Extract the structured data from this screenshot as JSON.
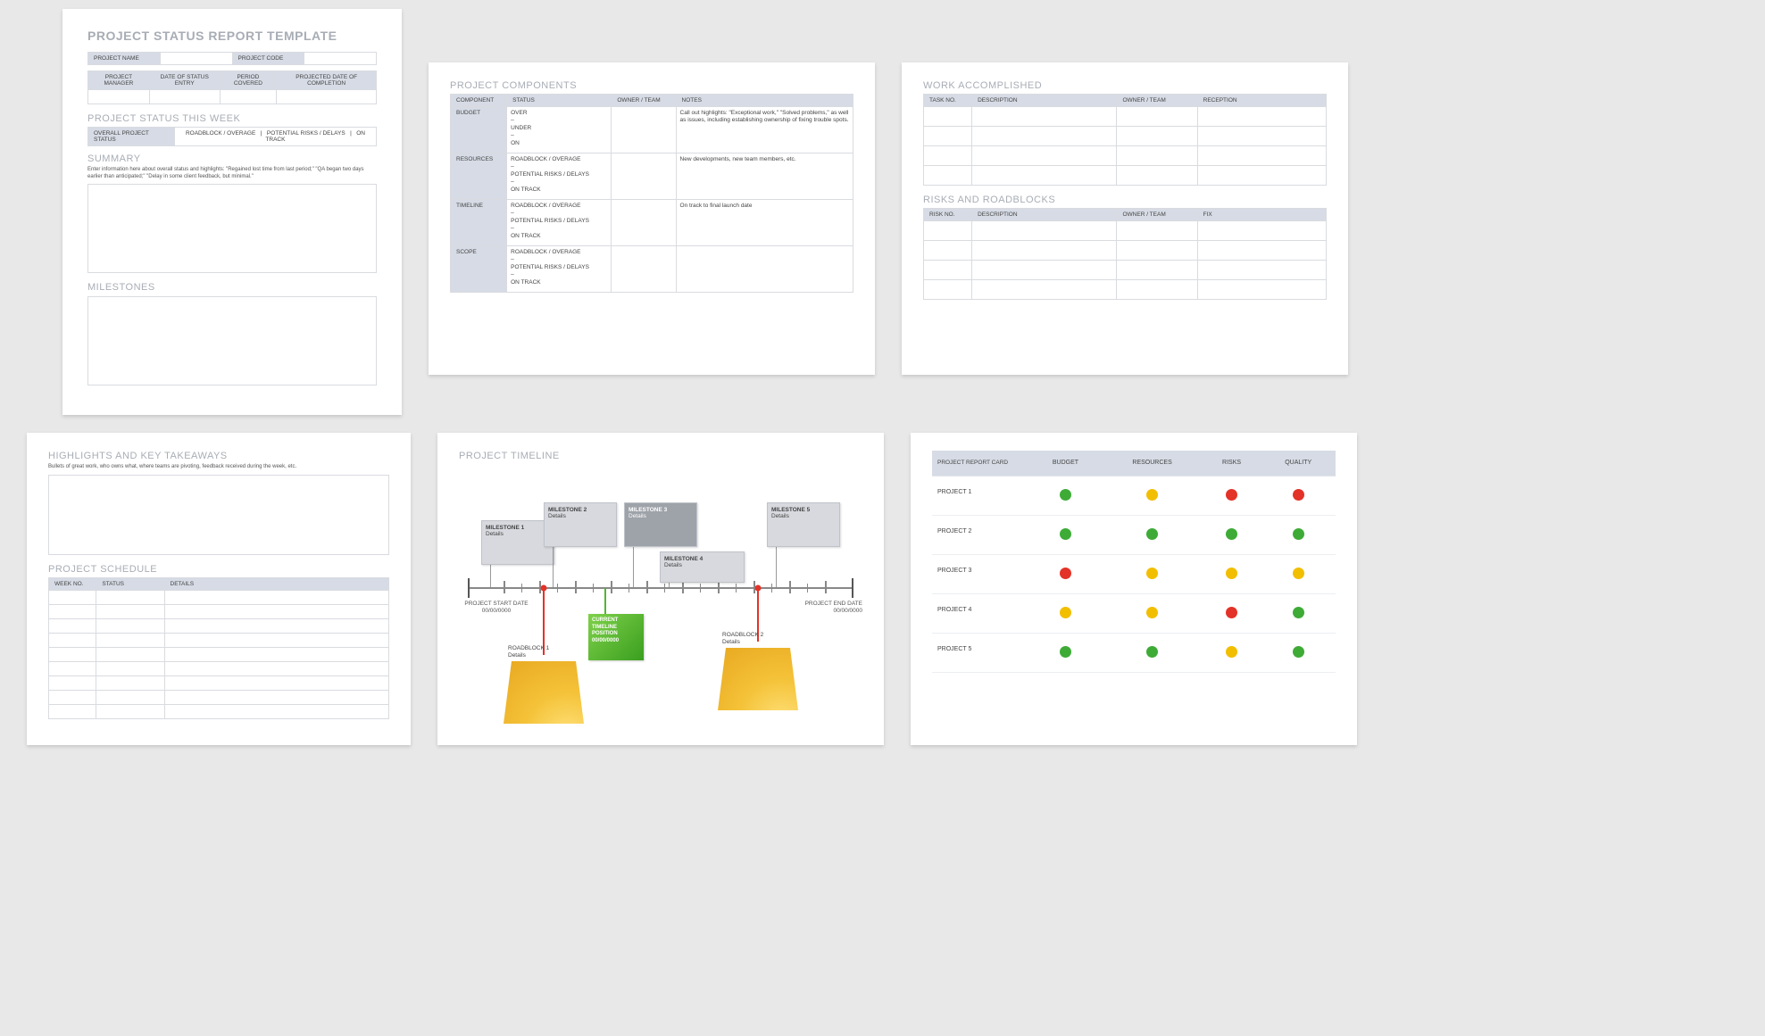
{
  "card1": {
    "title": "PROJECT STATUS REPORT TEMPLATE",
    "nameRow": {
      "name_label": "PROJECT NAME",
      "code_label": "PROJECT CODE"
    },
    "infoHeaders": [
      "PROJECT MANAGER",
      "DATE OF STATUS ENTRY",
      "PERIOD COVERED",
      "PROJECTED DATE OF COMPLETION"
    ],
    "statusSection": "PROJECT STATUS THIS WEEK",
    "statusRow": {
      "label": "OVERALL PROJECT STATUS",
      "items": [
        "ROADBLOCK / OVERAGE",
        "|",
        "POTENTIAL RISKS / DELAYS",
        "|",
        "ON TRACK"
      ]
    },
    "summary": {
      "title": "SUMMARY",
      "hint": "Enter information here about overall status and highlights: \"Regained lost time from last period;\" \"QA began two days earlier than anticipated;\" \"Delay in some client feedback, but minimal.\""
    },
    "milestones": {
      "title": "MILESTONES"
    }
  },
  "card2": {
    "title": "PROJECT COMPONENTS",
    "headers": [
      "COMPONENT",
      "STATUS",
      "OWNER / TEAM",
      "NOTES"
    ],
    "rows": [
      {
        "component": "BUDGET",
        "status": "OVER\n–\nUNDER\n–\nON",
        "owner": "",
        "notes": "Call out highlights: \"Exceptional work,\" \"Solved problems,\" as well as issues, including establishing ownership of fixing trouble spots."
      },
      {
        "component": "RESOURCES",
        "status": "ROADBLOCK / OVERAGE\n–\nPOTENTIAL RISKS / DELAYS\n–\nON TRACK",
        "owner": "",
        "notes": "New developments, new team members, etc."
      },
      {
        "component": "TIMELINE",
        "status": "ROADBLOCK / OVERAGE\n–\nPOTENTIAL RISKS / DELAYS\n–\nON TRACK",
        "owner": "",
        "notes": "On track to final launch date"
      },
      {
        "component": "SCOPE",
        "status": "ROADBLOCK / OVERAGE\n–\nPOTENTIAL RISKS / DELAYS\n–\nON TRACK",
        "owner": "",
        "notes": ""
      }
    ]
  },
  "card3": {
    "work": {
      "title": "WORK ACCOMPLISHED",
      "headers": [
        "TASK NO.",
        "DESCRIPTION",
        "OWNER / TEAM",
        "RECEPTION"
      ],
      "rows": 4
    },
    "risks": {
      "title": "RISKS AND ROADBLOCKS",
      "headers": [
        "RISK NO.",
        "DESCRIPTION",
        "OWNER / TEAM",
        "FIX"
      ],
      "rows": 4
    }
  },
  "card4": {
    "highlights": {
      "title": "HIGHLIGHTS AND KEY TAKEAWAYS",
      "hint": "Bullets of great work, who owns what, where teams are pivoting, feedback received during the week, etc."
    },
    "schedule": {
      "title": "PROJECT SCHEDULE",
      "headers": [
        "WEEK NO.",
        "STATUS",
        "DETAILS"
      ],
      "rows": 9
    }
  },
  "card5": {
    "title": "PROJECT TIMELINE",
    "start": {
      "label": "PROJECT START DATE",
      "date": "00/00/0000"
    },
    "end": {
      "label": "PROJECT END DATE",
      "date": "00/00/0000"
    },
    "milestones": [
      {
        "name": "MILESTONE 1",
        "detail": "Details"
      },
      {
        "name": "MILESTONE 2",
        "detail": "Details"
      },
      {
        "name": "MILESTONE 3",
        "detail": "Details"
      },
      {
        "name": "MILESTONE 4",
        "detail": "Details"
      },
      {
        "name": "MILESTONE 5",
        "detail": "Details"
      }
    ],
    "current": {
      "l1": "CURRENT",
      "l2": "TIMELINE",
      "l3": "POSITION",
      "date": "00/00/0000"
    },
    "roadblocks": [
      {
        "name": "ROADBLOCK 1",
        "detail": "Details"
      },
      {
        "name": "ROADBLOCK 2",
        "detail": "Details"
      }
    ]
  },
  "card6": {
    "header_label": "PROJECT REPORT CARD",
    "cols": [
      "BUDGET",
      "RESOURCES",
      "RISKS",
      "QUALITY"
    ],
    "rows": [
      {
        "name": "PROJECT 1",
        "vals": [
          "g",
          "y",
          "r",
          "r"
        ]
      },
      {
        "name": "PROJECT 2",
        "vals": [
          "g",
          "g",
          "g",
          "g"
        ]
      },
      {
        "name": "PROJECT 3",
        "vals": [
          "r",
          "y",
          "y",
          "y"
        ]
      },
      {
        "name": "PROJECT 4",
        "vals": [
          "y",
          "y",
          "r",
          "g"
        ]
      },
      {
        "name": "PROJECT 5",
        "vals": [
          "g",
          "g",
          "y",
          "g"
        ]
      }
    ]
  }
}
